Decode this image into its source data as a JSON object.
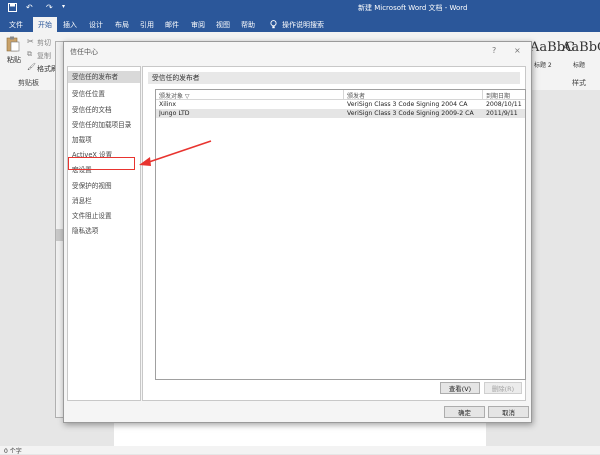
{
  "window": {
    "title": "新建 Microsoft Word 文档 - Word",
    "qa_save_icon": "save-icon",
    "qa_undo_icon": "undo-icon",
    "qa_redo_icon": "redo-icon",
    "qa_more_icon": "customize-icon"
  },
  "ribbon": {
    "tabs": [
      "文件",
      "开始",
      "插入",
      "设计",
      "布局",
      "引用",
      "邮件",
      "审阅",
      "视图",
      "帮助"
    ],
    "active_tab": "开始",
    "tell_me": "操作说明搜索",
    "clipboard": {
      "paste_label": "粘贴",
      "cut_label": "剪切",
      "copy_label": "复制",
      "format_painter_label": "格式刷",
      "group_label": "剪贴板"
    },
    "styles": {
      "preview_1": "AaBbC",
      "preview_1_name": "标题 2",
      "preview_2": "AaBbC",
      "preview_2_name": "标题",
      "group_label": "样式"
    }
  },
  "status": {
    "word_count": "0 个字"
  },
  "dialog": {
    "title": "信任中心",
    "help_glyph": "?",
    "close_glyph": "×",
    "nav_items": [
      "受信任的发布者",
      "受信任位置",
      "受信任的文档",
      "受信任的加载项目录",
      "加载项",
      "ActiveX 设置",
      "宏设置",
      "受保护的视图",
      "消息栏",
      "文件阻止设置",
      "隐私选项"
    ],
    "selected_nav": "受信任的发布者",
    "highlighted_nav": "宏设置",
    "section_title": "受信任的发布者",
    "columns": [
      "颁发对象 ▽",
      "颁发者",
      "到期日期"
    ],
    "rows": [
      {
        "issued_to": "Xilinx",
        "issuer": "VeriSign Class 3 Code Signing 2004 CA",
        "expiry": "2008/10/11"
      },
      {
        "issued_to": "Jungo LTD",
        "issuer": "VeriSign Class 3 Code Signing 2009-2 CA",
        "expiry": "2011/9/11"
      }
    ],
    "view_button": "查看(V)",
    "remove_button": "删除(R)",
    "ok_button": "确定",
    "cancel_button": "取消"
  },
  "colors": {
    "word_blue": "#2b579a",
    "annotation_red": "#e8342f"
  }
}
